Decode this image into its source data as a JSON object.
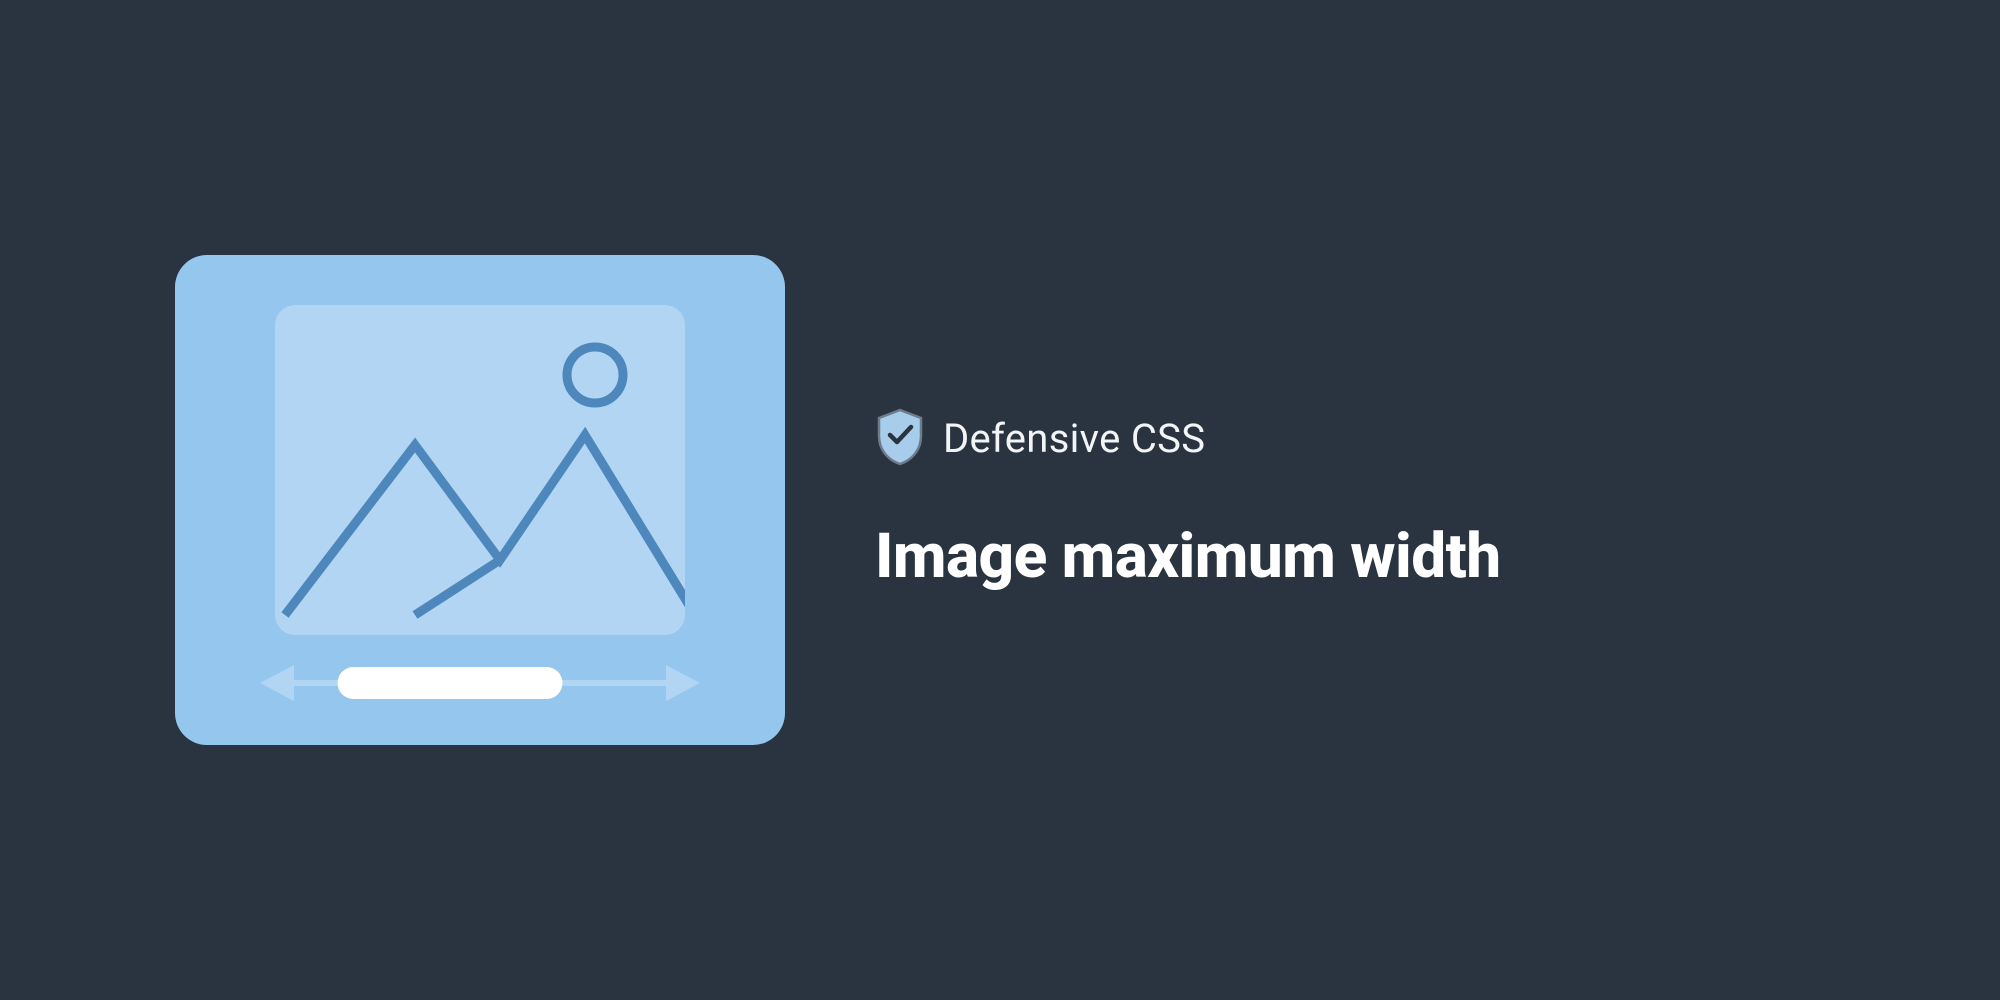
{
  "brand": {
    "label": "Defensive CSS"
  },
  "article": {
    "title": "Image maximum width"
  },
  "colors": {
    "background": "#2a3441",
    "card": "#95c6ed",
    "frame": "#b1d5f2",
    "stroke": "#4d87bb",
    "white": "#ffffff"
  }
}
